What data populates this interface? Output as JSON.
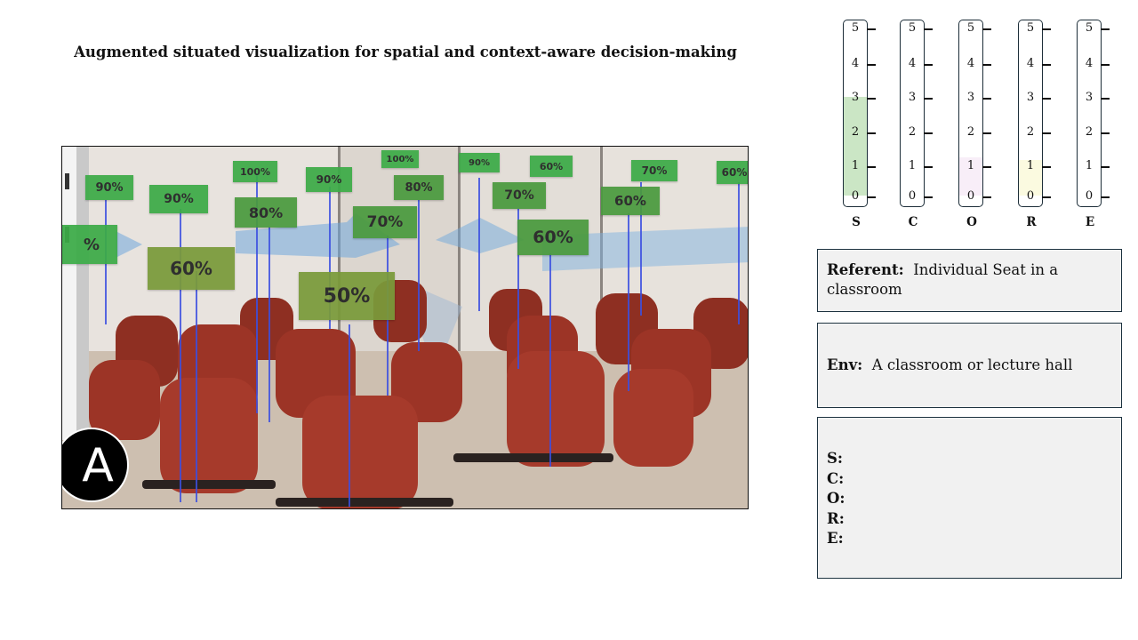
{
  "title": "Augmented situated visualization for spatial and context-aware decision-making",
  "figure": {
    "badge_letter": "A",
    "labels": [
      "90%",
      "90%",
      "100%",
      "90%",
      "100%",
      "80%",
      "90%",
      "80%",
      "70%",
      "70%",
      "60%",
      "60%",
      "50%",
      "70%",
      "60%",
      "60%",
      "%"
    ]
  },
  "gauges": [
    {
      "letter": "S",
      "ticks": [
        "5",
        "4",
        "3",
        "2",
        "1",
        "0"
      ],
      "fill_level": 3,
      "fill_color": "#cbe6c5"
    },
    {
      "letter": "C",
      "ticks": [
        "5",
        "4",
        "3",
        "2",
        "1",
        "0"
      ],
      "fill_level": 0,
      "fill_color": "#ffffff"
    },
    {
      "letter": "O",
      "ticks": [
        "5",
        "4",
        "3",
        "2",
        "1",
        "0"
      ],
      "fill_level": 1.2,
      "fill_color": "#f8eef8"
    },
    {
      "letter": "R",
      "ticks": [
        "5",
        "4",
        "3",
        "2",
        "1",
        "0"
      ],
      "fill_level": 1.1,
      "fill_color": "#fbfae0"
    },
    {
      "letter": "E",
      "ticks": [
        "5",
        "4",
        "3",
        "2",
        "1",
        "0"
      ],
      "fill_level": 0,
      "fill_color": "#ffffff"
    }
  ],
  "referent": {
    "label": "Referent:",
    "text": "Individual Seat in a classroom"
  },
  "env": {
    "label": "Env:",
    "text": "A classroom or lecture hall"
  },
  "score_fields": [
    "S:",
    "C:",
    "O:",
    "R:",
    "E:"
  ]
}
